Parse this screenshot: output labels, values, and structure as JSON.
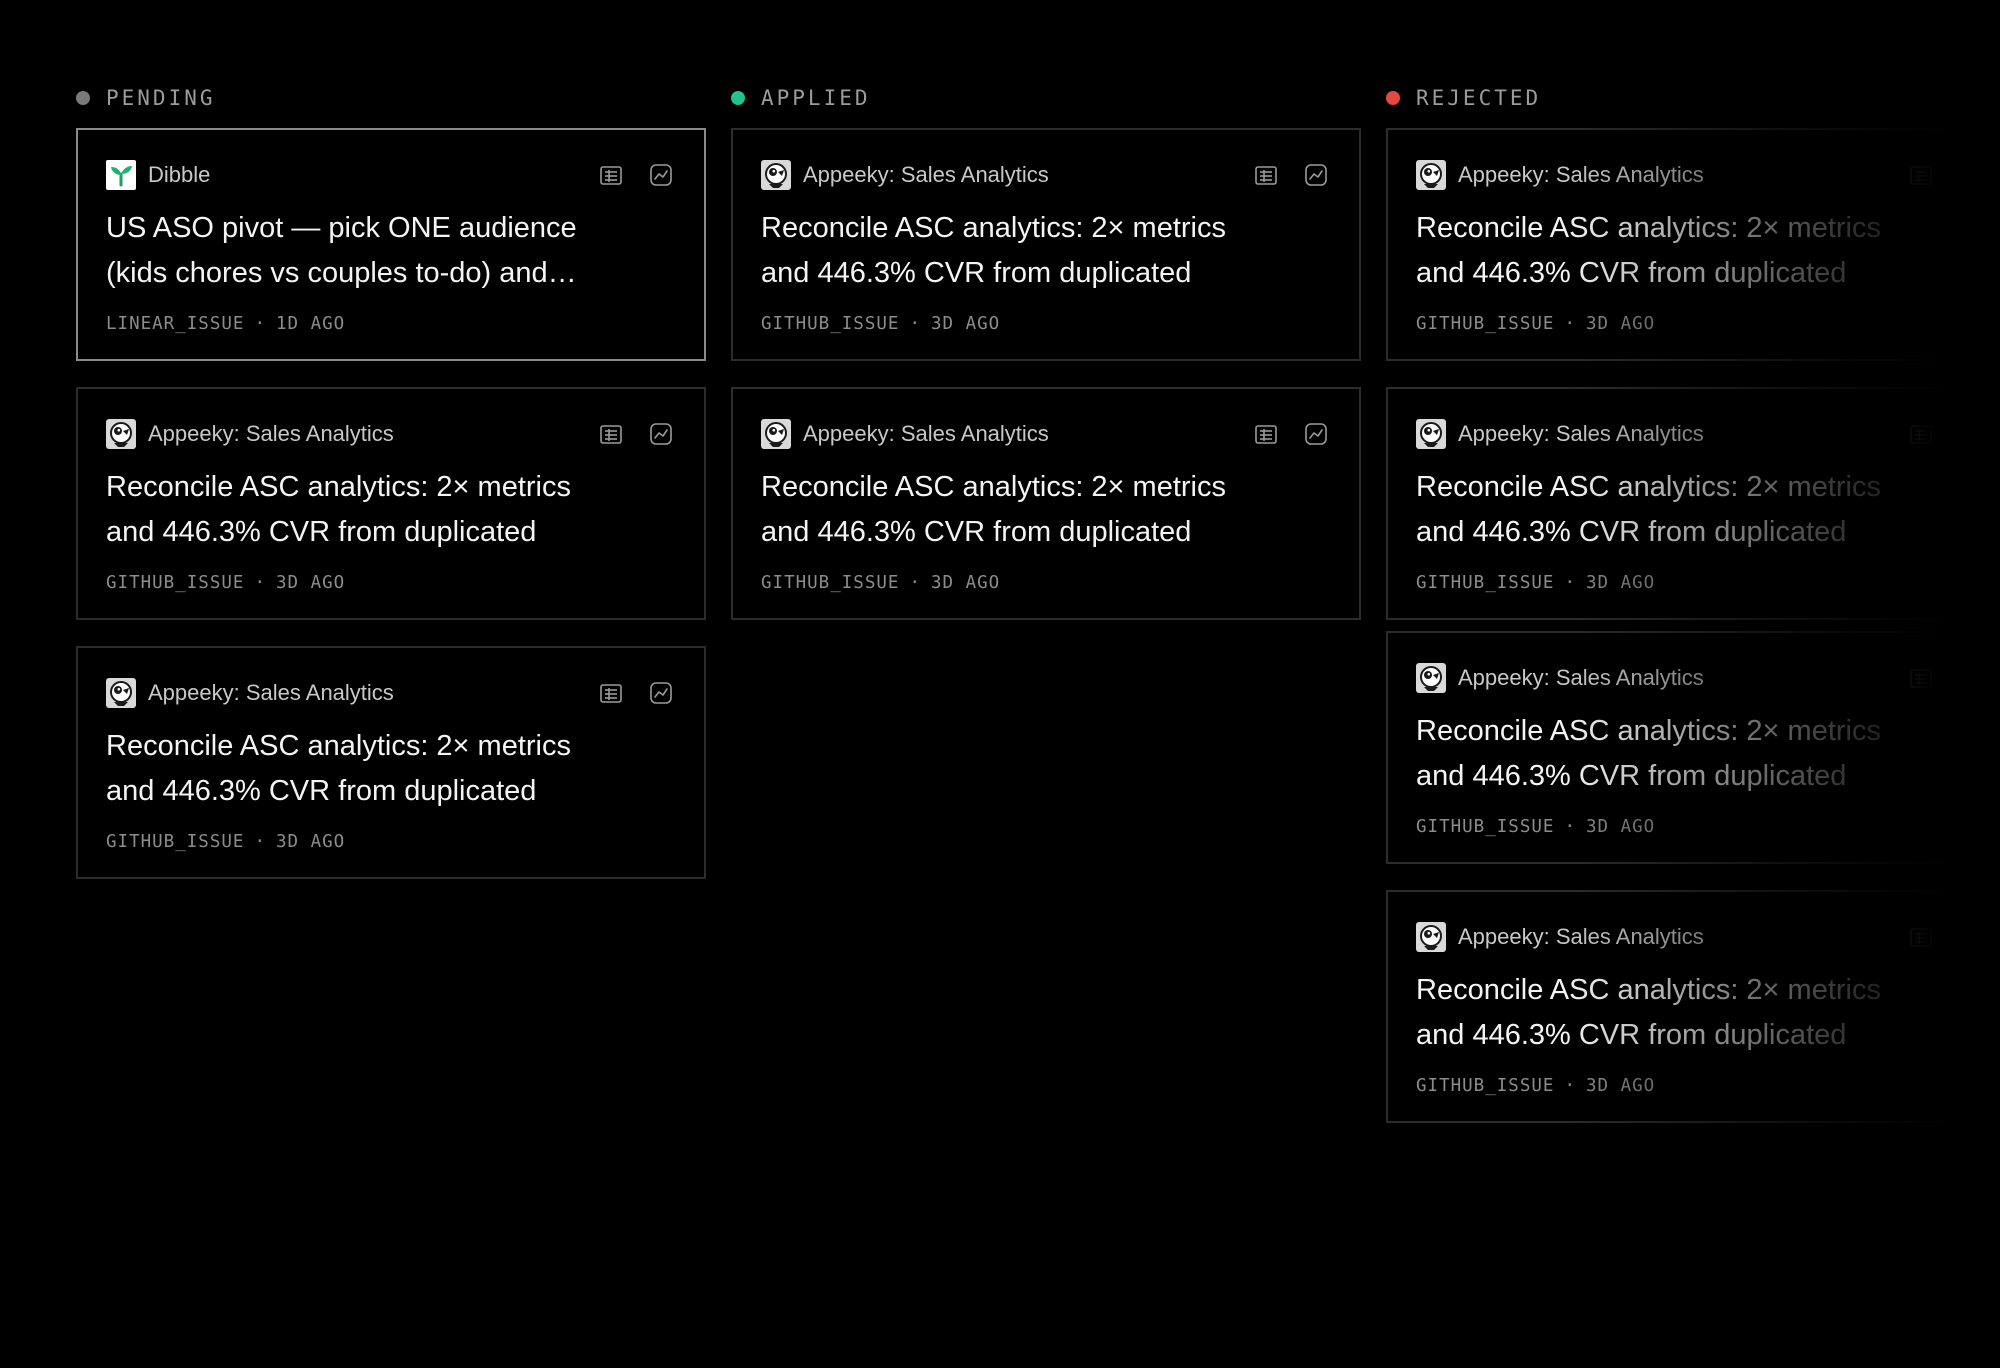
{
  "columns": [
    {
      "key": "pending",
      "title": "PENDING",
      "dot_color": "#7a7a7a",
      "cards": [
        {
          "source": "Dibble",
          "logo": "sprout-logo",
          "title": "US ASO pivot — pick ONE audience (kids chores vs couples to-do) and…",
          "type": "LINEAR_ISSUE",
          "age": "1D AGO",
          "selected": true
        },
        {
          "source": "Appeeky: Sales Analytics",
          "logo": "appeeky-logo",
          "title": "Reconcile ASC analytics: 2× metrics and 446.3% CVR from duplicated",
          "type": "GITHUB_ISSUE",
          "age": "3D AGO",
          "selected": false
        },
        {
          "source": "Appeeky: Sales Analytics",
          "logo": "appeeky-logo",
          "title": "Reconcile ASC analytics: 2× metrics and 446.3% CVR from duplicated",
          "type": "GITHUB_ISSUE",
          "age": "3D AGO",
          "selected": false
        }
      ]
    },
    {
      "key": "applied",
      "title": "APPLIED",
      "dot_color": "#22c38e",
      "cards": [
        {
          "source": "Appeeky: Sales Analytics",
          "logo": "appeeky-logo",
          "title": "Reconcile ASC analytics: 2× metrics and 446.3% CVR from duplicated",
          "type": "GITHUB_ISSUE",
          "age": "3D AGO",
          "selected": false
        },
        {
          "source": "Appeeky: Sales Analytics",
          "logo": "appeeky-logo",
          "title": "Reconcile ASC analytics: 2× metrics and 446.3% CVR from duplicated",
          "type": "GITHUB_ISSUE",
          "age": "3D AGO",
          "selected": false
        }
      ]
    },
    {
      "key": "rejected",
      "title": "REJECTED",
      "dot_color": "#e5483e",
      "cards": [
        {
          "source": "Appeeky: Sales Analytics",
          "logo": "appeeky-logo",
          "title": "Reconcile ASC analytics: 2× metrics and 446.3% CVR from duplicated",
          "type": "GITHUB_ISSUE",
          "age": "3D AGO",
          "selected": false
        },
        {
          "source": "Appeeky: Sales Analytics",
          "logo": "appeeky-logo",
          "title": "Reconcile ASC analytics: 2× metrics and 446.3% CVR from duplicated",
          "type": "GITHUB_ISSUE",
          "age": "3D AGO",
          "selected": false
        },
        {
          "source": "Appeeky: Sales Analytics",
          "logo": "appeeky-logo",
          "title": "Reconcile ASC analytics: 2× metrics and 446.3% CVR from duplicated",
          "type": "GITHUB_ISSUE",
          "age": "3D AGO",
          "selected": false
        },
        {
          "source": "Appeeky: Sales Analytics",
          "logo": "appeeky-logo",
          "title": "Reconcile ASC analytics: 2× metrics and 446.3% CVR from duplicated",
          "type": "GITHUB_ISSUE",
          "age": "3D AGO",
          "selected": false
        }
      ]
    }
  ],
  "card_actions": [
    {
      "name": "document-icon"
    },
    {
      "name": "chart-icon"
    }
  ],
  "meta_separator": "·"
}
